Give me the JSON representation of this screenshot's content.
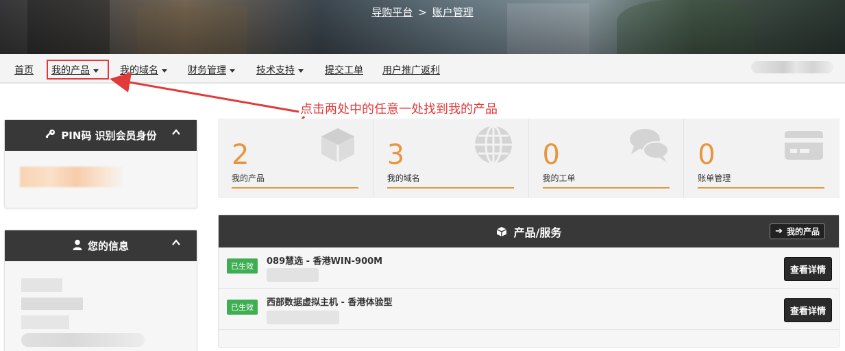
{
  "breadcrumb": {
    "parent": "导购平台",
    "separator": ">",
    "current": "账户管理"
  },
  "nav": {
    "items": [
      {
        "label": "首页",
        "dropdown": false
      },
      {
        "label": "我的产品",
        "dropdown": true
      },
      {
        "label": "我的域名",
        "dropdown": true
      },
      {
        "label": "财务管理",
        "dropdown": true
      },
      {
        "label": "技术支持",
        "dropdown": true
      },
      {
        "label": "提交工单",
        "dropdown": false
      },
      {
        "label": "用户推广返利",
        "dropdown": false
      }
    ]
  },
  "annotation": {
    "text": "点击两处中的任意一处找到我的产品",
    "color": "#e23a3a"
  },
  "pin_panel": {
    "title": "PIN码 识别会员身份",
    "icon": "key-icon"
  },
  "info_panel": {
    "title": "您的信息",
    "icon": "user-icon"
  },
  "stats": [
    {
      "value": "2",
      "label": "我的产品",
      "icon": "cube-icon"
    },
    {
      "value": "3",
      "label": "我的域名",
      "icon": "globe-icon"
    },
    {
      "value": "0",
      "label": "我的工单",
      "icon": "chat-icon"
    },
    {
      "value": "0",
      "label": "账单管理",
      "icon": "credit-card-icon"
    }
  ],
  "products": {
    "title": "产品/服务",
    "my_products_button": "我的产品",
    "rows": [
      {
        "status": "已生效",
        "name": "089慧选 - 香港WIN-900M",
        "action": "查看详情"
      },
      {
        "status": "已生效",
        "name": "西部数据虚拟主机 - 香港体验型",
        "action": "查看详情"
      }
    ]
  },
  "colors": {
    "accent": "#e8953f",
    "header_dark": "#383838",
    "status_green": "#3fae52",
    "annotation_red": "#e23a3a"
  }
}
